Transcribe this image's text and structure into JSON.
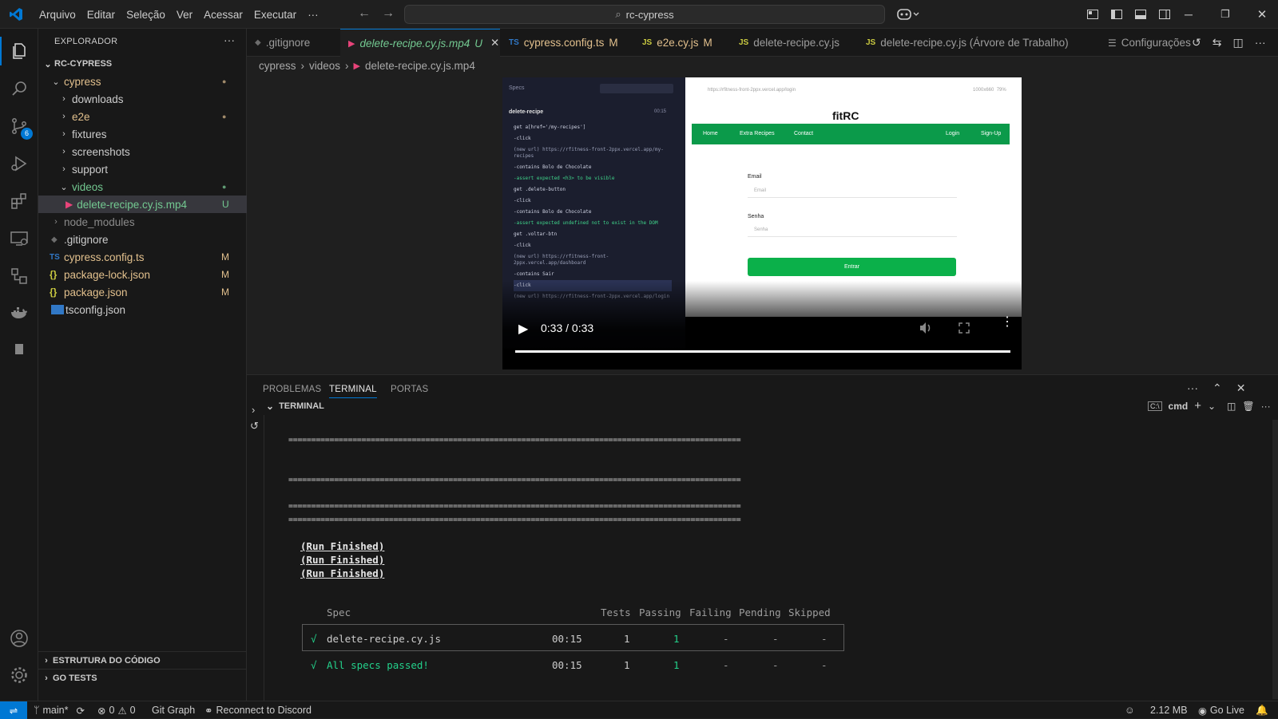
{
  "titlebar": {
    "menu": [
      "Arquivo",
      "Editar",
      "Seleção",
      "Ver",
      "Acessar",
      "Executar",
      "···"
    ],
    "search": "rc-cypress"
  },
  "activity": {
    "scm_badge": "6"
  },
  "sidebar": {
    "title": "EXPLORADOR",
    "more": "···",
    "root": "RC-CYPRESS",
    "items": [
      {
        "label": "cypress",
        "status": "●"
      },
      {
        "label": "downloads",
        "status": ""
      },
      {
        "label": "e2e",
        "status": "●"
      },
      {
        "label": "fixtures",
        "status": ""
      },
      {
        "label": "screenshots",
        "status": ""
      },
      {
        "label": "support",
        "status": ""
      },
      {
        "label": "videos",
        "status": "●"
      },
      {
        "label": "delete-recipe.cy.js.mp4",
        "status": "U"
      },
      {
        "label": "node_modules",
        "status": ""
      },
      {
        "label": ".gitignore",
        "status": ""
      },
      {
        "label": "cypress.config.ts",
        "status": "M"
      },
      {
        "label": "package-lock.json",
        "status": "M"
      },
      {
        "label": "package.json",
        "status": "M"
      },
      {
        "label": "tsconfig.json",
        "status": ""
      }
    ],
    "sections": [
      "ESTRUTURA DO CÓDIGO",
      "GO TESTS"
    ]
  },
  "tabs": [
    {
      "label": ".gitignore",
      "status": ""
    },
    {
      "label": "delete-recipe.cy.js.mp4",
      "status": "U"
    },
    {
      "label": "cypress.config.ts",
      "status": "M"
    },
    {
      "label": "e2e.cy.js",
      "status": "M"
    },
    {
      "label": "delete-recipe.cy.js",
      "status": ""
    },
    {
      "label": "delete-recipe.cy.js (Árvore de Trabalho)",
      "status": ""
    },
    {
      "label": "Configurações",
      "status": ""
    }
  ],
  "breadcrumb": [
    "cypress",
    "videos",
    "delete-recipe.cy.js.mp4"
  ],
  "video": {
    "time": "0:33 / 0:33",
    "specs_label": "Specs",
    "spec_name": "delete-recipe",
    "spec_time": "00:15",
    "url": "https://rfitness-front-2ppx.vercel.app/login",
    "viewport": "1000x660  79%",
    "logo": "fitRC",
    "nav": [
      "Home",
      "Extra Recipes",
      "Contact",
      "Login",
      "Sign-Up"
    ],
    "email_label": "Email",
    "email_placeholder": "Email",
    "senha_label": "Senha",
    "senha_placeholder": "Senha",
    "button": "Entrar",
    "log": [
      "get  a[href='/my-recipes']",
      "-click",
      "(new url)  https://rfitness-front-2ppx.vercel.app/my-recipes",
      "-contains  Bolo de Chocolate",
      "-assert  expected <h3> to be visible",
      "get  .delete-button",
      "-click",
      "-contains  Bolo de Chocolate",
      "-assert  expected undefined not to exist in the DOM",
      "get  .voltar-btn",
      "-click",
      "(new url)  https://rfitness-front-2ppx.vercel.app/dashboard",
      "-contains  Sair",
      "-click",
      "(new url)  https://rfitness-front-2ppx.vercel.app/login"
    ]
  },
  "panel": {
    "tabs": [
      "PROBLEMAS",
      "TERMINAL",
      "PORTAS"
    ],
    "terminal_header": "TERMINAL",
    "shell": "cmd",
    "separator": "===================================================================================================",
    "run_finished": [
      "(Run Finished)",
      "(Run Finished)",
      "(Run Finished)"
    ],
    "table_headers": [
      "Spec",
      "Tests",
      "Passing",
      "Failing",
      "Pending",
      "Skipped"
    ],
    "rows": [
      {
        "mark": "√",
        "spec": "delete-recipe.cy.js",
        "time": "00:15",
        "tests": "1",
        "passing": "1",
        "failing": "-",
        "pending": "-",
        "skipped": "-"
      },
      {
        "mark": "√",
        "spec": "All specs passed!",
        "time": "00:15",
        "tests": "1",
        "passing": "1",
        "failing": "-",
        "pending": "-",
        "skipped": "-"
      }
    ]
  },
  "status": {
    "branch": "main*",
    "errors": "0",
    "warnings": "0",
    "git_graph": "Git Graph",
    "discord": "Reconnect to Discord",
    "memory": "2.12 MB",
    "golive": "Go Live"
  }
}
